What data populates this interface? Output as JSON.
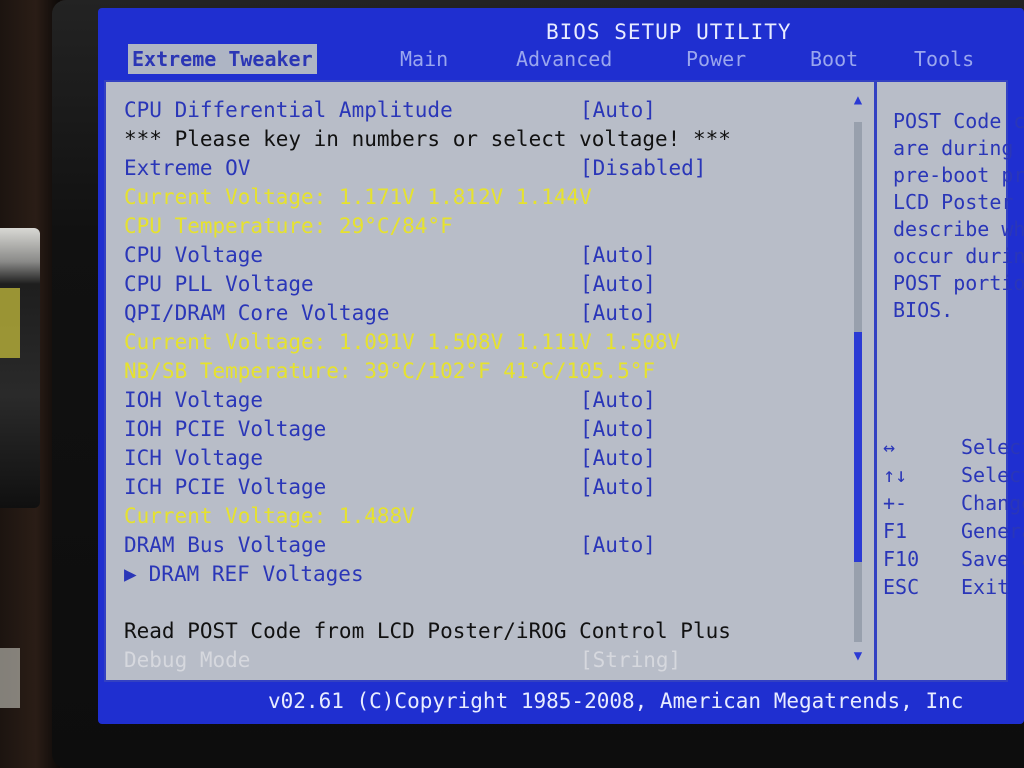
{
  "bios": {
    "title": "BIOS SETUP UTILITY",
    "tabs": [
      {
        "label": "Extreme Tweaker",
        "active": true
      },
      {
        "label": "Main"
      },
      {
        "label": "Advanced"
      },
      {
        "label": "Power"
      },
      {
        "label": "Boot"
      },
      {
        "label": "Tools"
      }
    ],
    "settings": [
      {
        "label": "CPU Differential Amplitude",
        "value": "[Auto]",
        "color": "blue"
      },
      {
        "label": "*** Please key in numbers or select voltage! ***",
        "value": "",
        "color": "black"
      },
      {
        "label": "Extreme OV",
        "value": "[Disabled]",
        "color": "blue"
      },
      {
        "label": "Current Voltage: 1.171V  1.812V  1.144V",
        "value": "",
        "color": "yellow"
      },
      {
        "label": "CPU Temperature: 29°C/84°F",
        "value": "",
        "color": "yellow"
      },
      {
        "label": "CPU Voltage",
        "value": "[Auto]",
        "color": "blue"
      },
      {
        "label": "CPU PLL Voltage",
        "value": "[Auto]",
        "color": "blue"
      },
      {
        "label": "QPI/DRAM Core Voltage",
        "value": "[Auto]",
        "color": "blue"
      },
      {
        "label": "Current Voltage: 1.091V  1.508V  1.111V  1.508V",
        "value": "",
        "color": "yellow"
      },
      {
        "label": "NB/SB Temperature: 39°C/102°F  41°C/105.5°F",
        "value": "",
        "color": "yellow"
      },
      {
        "label": "IOH Voltage",
        "value": "[Auto]",
        "color": "blue"
      },
      {
        "label": "IOH PCIE Voltage",
        "value": "[Auto]",
        "color": "blue"
      },
      {
        "label": "ICH Voltage",
        "value": "[Auto]",
        "color": "blue"
      },
      {
        "label": "ICH PCIE Voltage",
        "value": "[Auto]",
        "color": "blue"
      },
      {
        "label": "Current Voltage: 1.488V",
        "value": "",
        "color": "yellow"
      },
      {
        "label": "DRAM Bus Voltage",
        "value": "[Auto]",
        "color": "blue"
      },
      {
        "label": "DRAM REF Voltages",
        "value": "",
        "color": "blue",
        "submenu": true
      }
    ],
    "bottom_settings": [
      {
        "label": "Read POST Code from LCD Poster/iROG Control Plus",
        "value": "",
        "color": "black"
      },
      {
        "label": "Debug Mode",
        "value": "[String]",
        "color": "grey"
      }
    ],
    "help_lines": [
      "POST Code c",
      "are during",
      "pre-boot pr",
      "LCD Poster",
      "describe wh",
      "occur durin",
      "POST portio",
      "BIOS."
    ],
    "keys": [
      {
        "key": "↔",
        "desc": "Select"
      },
      {
        "key": "↑↓",
        "desc": "Select"
      },
      {
        "key": "+-",
        "desc": "Change"
      },
      {
        "key": "F1",
        "desc": "Genera"
      },
      {
        "key": "F10",
        "desc": "Save a"
      },
      {
        "key": "ESC",
        "desc": "Exit"
      }
    ],
    "footer": "v02.61 (C)Copyright 1985-2008, American Megatrends, Inc",
    "colors": {
      "screen": "#1f2fd0",
      "panel": "#b8bdc8",
      "blue_text": "#2a36b8",
      "yellow_text": "#e6e22e"
    }
  }
}
